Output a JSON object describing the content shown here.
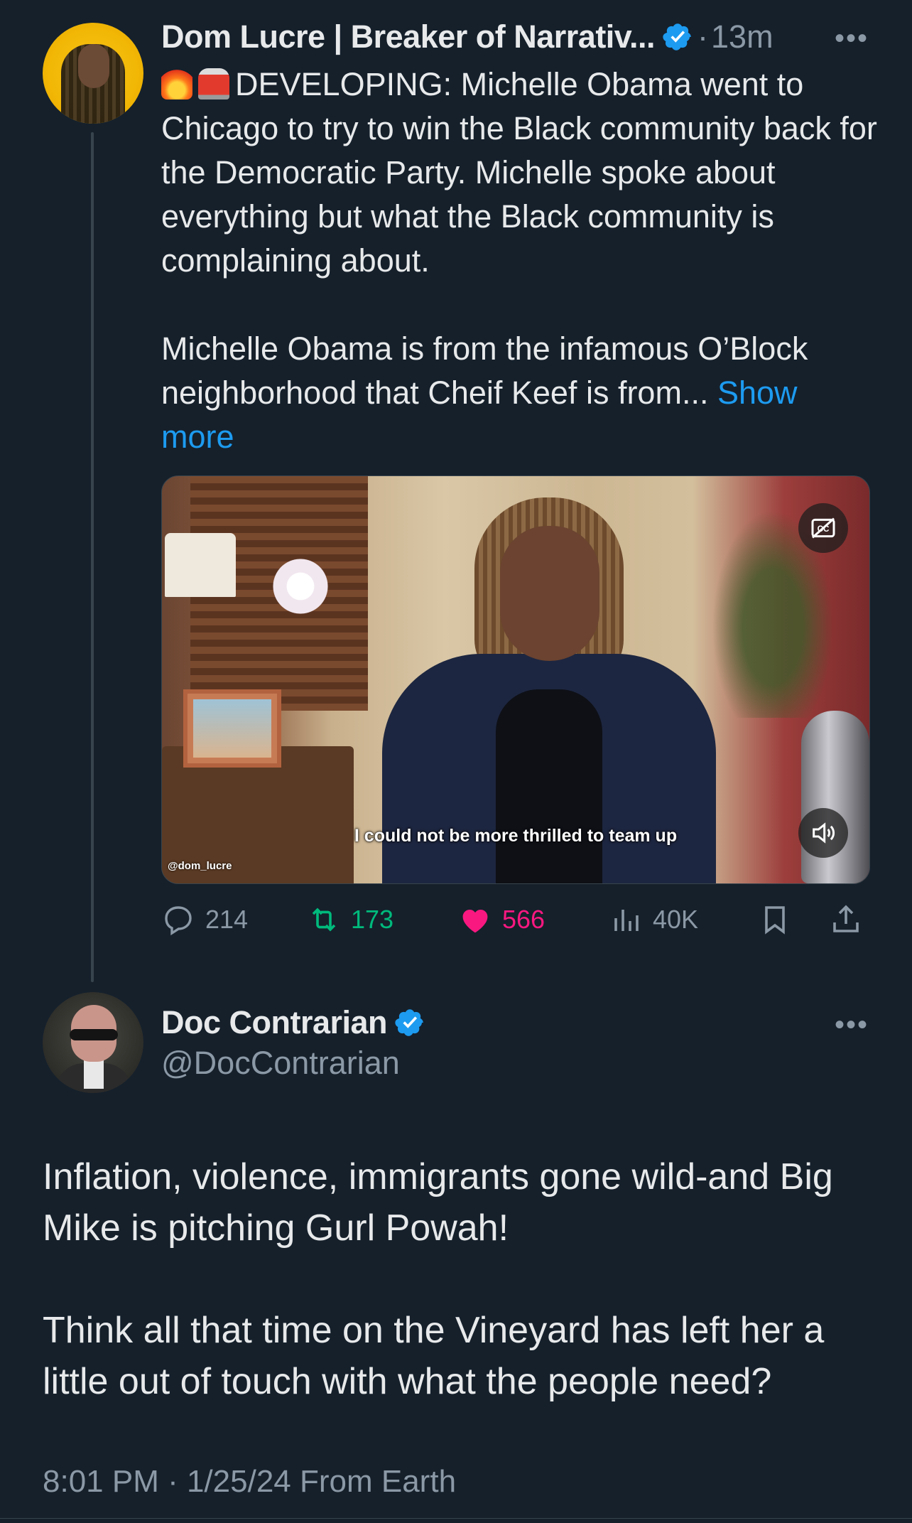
{
  "tweet1": {
    "author_name": "Dom Lucre | Breaker of Narrativ...",
    "time": "13m",
    "time_separator": "·",
    "more_label": "•••",
    "text_main": "DEVELOPING: Michelle Obama went to Chicago to try to win the Black community back for the Democratic Party. Michelle spoke about everything but what the Black community is complaining about.\n\nMichelle Obama is from the infamous O’Block neighborhood that Cheif Keef is from... ",
    "show_more": "Show more",
    "emojis": [
      "fire-emoji",
      "police-light-emoji"
    ],
    "media": {
      "caption": "I could not be more thrilled to team up",
      "watermark": "@dom_lucre",
      "cc_icon": "captions-off-icon",
      "volume_icon": "volume-icon"
    },
    "stats": {
      "replies": "214",
      "retweets": "173",
      "likes": "566",
      "views": "40K"
    }
  },
  "tweet2": {
    "author_name": "Doc Contrarian",
    "handle": "@DocContrarian",
    "more_label": "•••",
    "text": "Inflation, violence, immigrants gone wild-and Big Mike is pitching Gurl Powah!\n\nThink all that time on the Vineyard has left her a little out of touch with what the people need?",
    "timestamp": "8:01 PM · 1/25/24 From Earth"
  },
  "colors": {
    "background": "#15202b",
    "text": "#e7e9ea",
    "muted": "#8b98a5",
    "link": "#1d9bf0",
    "retweet": "#00ba7c",
    "like": "#f91880",
    "verified": "#1d9bf0"
  }
}
